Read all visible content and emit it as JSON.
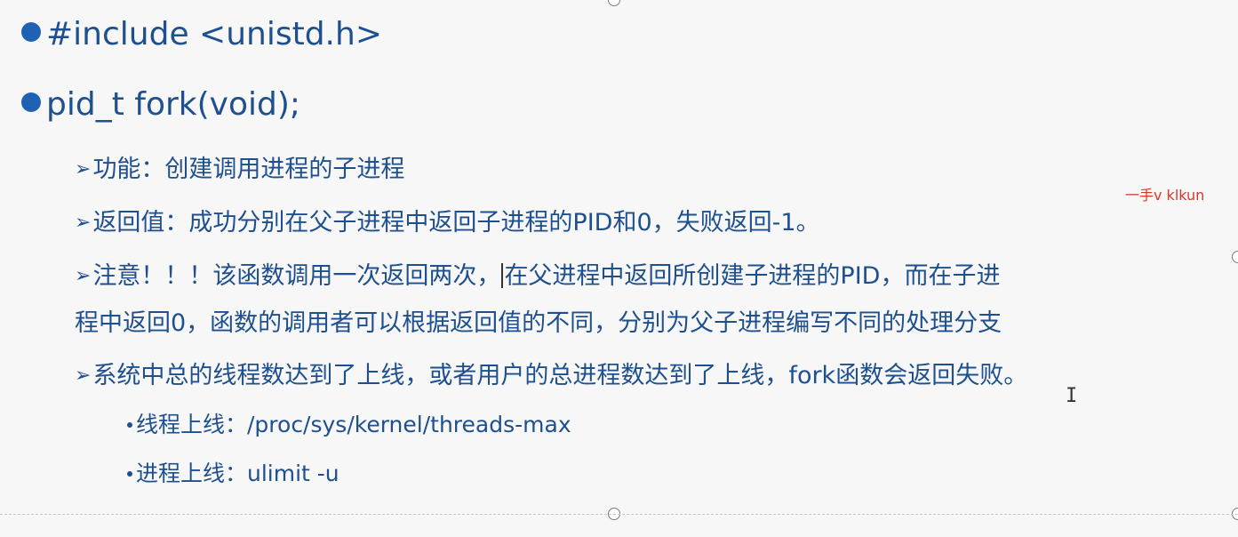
{
  "bullets": [
    {
      "text": "#include <unistd.h>"
    },
    {
      "text": "pid_t fork(void);"
    }
  ],
  "sub_items": {
    "function": "功能：创建调用进程的子进程",
    "return_value": "返回值：成功分别在父子进程中返回子进程的PID和0，失败返回-1。",
    "note_part1": "注意！！！该函数调用一次返回两次，",
    "note_part2": "在父进程中返回所创建子进程的PID，而在子进",
    "note_line2": "程中返回0，函数的调用者可以根据返回值的不同，分别为父子进程编写不同的处理分支",
    "limit": "系统中总的线程数达到了上线，或者用户的总进程数达到了上线，fork函数会返回失败。"
  },
  "limits": [
    {
      "text": "线程上线：/proc/sys/kernel/threads-max"
    },
    {
      "text": "进程上线：ulimit -u"
    }
  ],
  "annotation": "一手v klkun",
  "colors": {
    "text": "#1e4f8e",
    "bullet": "#1f62b3",
    "annotation": "#d63a2a",
    "background": "#f7f7f7"
  }
}
